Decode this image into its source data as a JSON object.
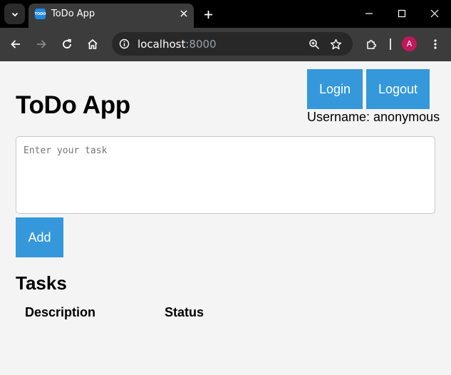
{
  "browser": {
    "tab": {
      "title": "ToDo App",
      "favicon_text": "TODO"
    },
    "address": {
      "host": "localhost",
      "port": ":8000"
    },
    "profile_initial": "A",
    "colors": {
      "tabstrip": "#000000",
      "toolbar": "#3c3c3c",
      "omnibox": "#282828",
      "avatar": "#c2185b"
    }
  },
  "app": {
    "title": "ToDo App",
    "login_label": "Login",
    "logout_label": "Logout",
    "username_text": "Username: anonymous",
    "task_input": {
      "placeholder": "Enter your task",
      "value": ""
    },
    "add_label": "Add",
    "tasks_heading": "Tasks",
    "table": {
      "columns": [
        "Description",
        "Status"
      ],
      "rows": []
    },
    "colors": {
      "accent": "#3498db",
      "background": "#f4f4f4"
    }
  }
}
